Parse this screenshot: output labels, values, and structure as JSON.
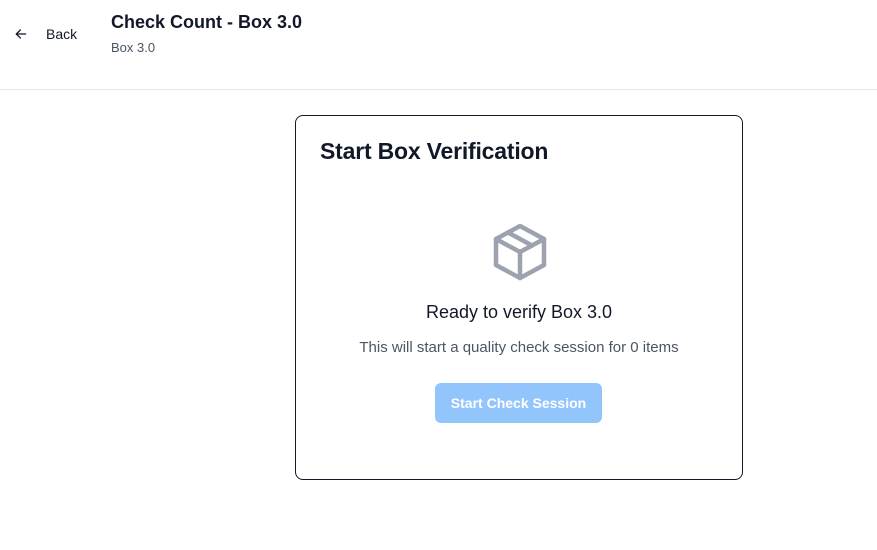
{
  "header": {
    "back_label": "Back",
    "back_icon": "arrow-left-icon",
    "title": "Check Count - Box 3.0",
    "subtitle": "Box 3.0"
  },
  "card": {
    "title": "Start Box Verification",
    "icon": "package-icon",
    "ready_text": "Ready to verify Box 3.0",
    "description": "This will start a quality check session for 0 items",
    "start_button_label": "Start Check Session",
    "start_button_disabled": true
  },
  "colors": {
    "primary_disabled": "#93c5fd",
    "icon_gray": "#9ca3af",
    "text_dark": "#111827",
    "text_muted": "#4b5563",
    "divider": "#e5e7eb"
  }
}
